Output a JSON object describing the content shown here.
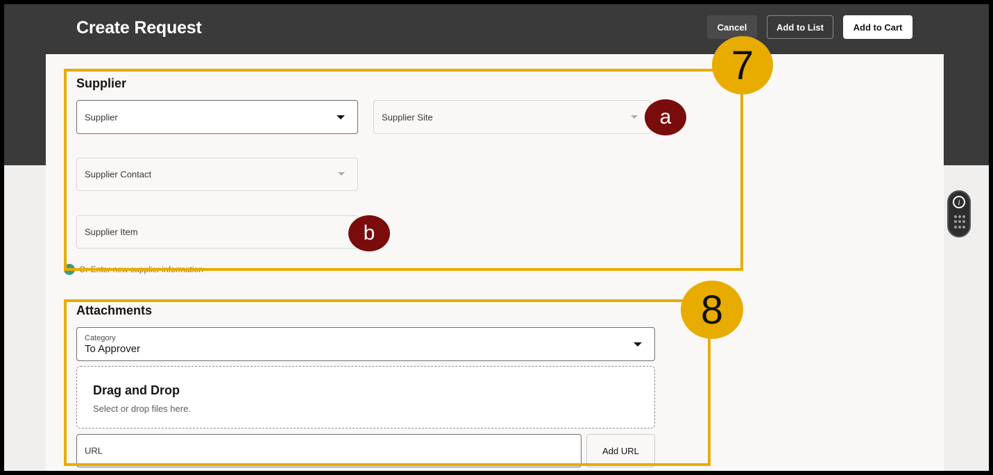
{
  "header": {
    "title": "Create Request",
    "buttons": {
      "cancel": "Cancel",
      "add_to_list": "Add to List",
      "add_to_cart": "Add to Cart"
    }
  },
  "supplier": {
    "section_title": "Supplier",
    "fields": {
      "supplier": "Supplier",
      "supplier_site": "Supplier Site",
      "supplier_contact": "Supplier Contact",
      "supplier_item": "Supplier Item"
    },
    "new_supplier_link": "Or Enter new supplier information"
  },
  "attachments": {
    "section_title": "Attachments",
    "category": {
      "label": "Category",
      "value": "To Approver"
    },
    "dropzone": {
      "title": "Drag and Drop",
      "hint": "Select or drop files here."
    },
    "url": {
      "label": "URL",
      "button": "Add URL"
    }
  },
  "annotations": {
    "callout_7": "7",
    "callout_8": "8",
    "marker_a": "a",
    "marker_b": "b",
    "color": "#e8ac00",
    "marker_color": "#7a0c0c"
  },
  "icons": [
    "chevron-down-icon",
    "info-icon",
    "grid-menu-icon"
  ]
}
